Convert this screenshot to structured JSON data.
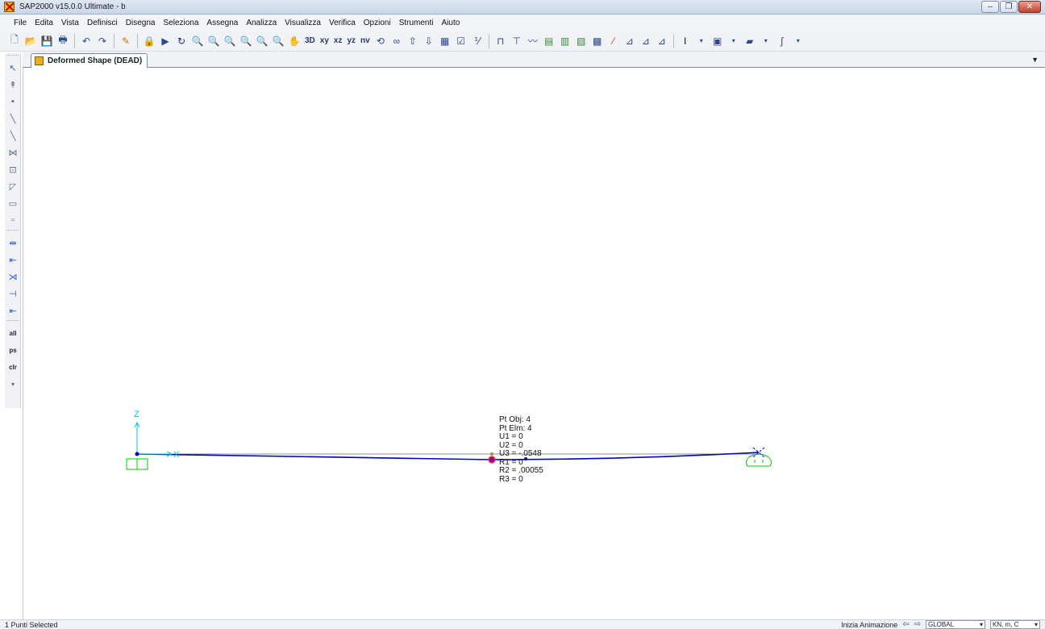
{
  "window": {
    "title": "SAP2000 v15.0.0 Ultimate  - b",
    "buttons": [
      "–",
      "❐",
      "✕"
    ]
  },
  "menu": [
    "File",
    "Edita",
    "Vista",
    "Definisci",
    "Disegna",
    "Seleziona",
    "Assegna",
    "Analizza",
    "Visualizza",
    "Verifica",
    "Opzioni",
    "Strumenti",
    "Aiuto"
  ],
  "toolbar": {
    "view_labels": [
      "3D",
      "xy",
      "xz",
      "yz",
      "nv"
    ]
  },
  "left_toolbar": {
    "text_buttons": [
      "all",
      "ps",
      "clr"
    ]
  },
  "tab": {
    "title": "Deformed Shape (DEAD)"
  },
  "model": {
    "axis_labels": {
      "z": "Z",
      "x": "X"
    },
    "point_info": [
      "Pt Obj: 4",
      "Pt Elm: 4",
      "U1 =  0",
      "U2 =  0",
      "U3 = -.0548",
      "R1 =  0",
      "R2 =  .00055",
      "R3 =  0"
    ],
    "colors": {
      "undeformed": "#909090",
      "deformed": "#0000c8",
      "support": "#00cc00",
      "axis": "#00c8e8",
      "selected_joint": "#a01070"
    }
  },
  "status": {
    "selection": "1 Punti Selected",
    "animation": "Inizia Animazione",
    "coord_system": "GLOBAL",
    "units": "KN, m, C"
  }
}
